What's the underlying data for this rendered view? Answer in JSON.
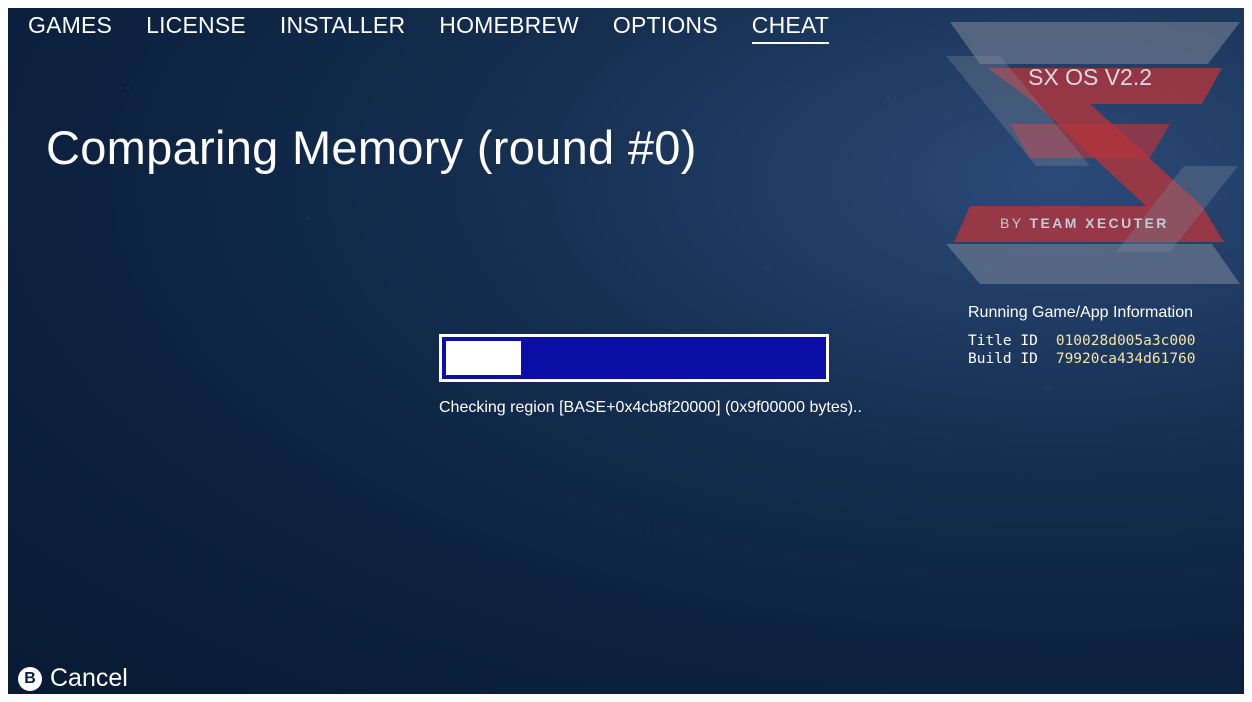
{
  "nav": {
    "items": [
      {
        "label": "GAMES",
        "active": false
      },
      {
        "label": "LICENSE",
        "active": false
      },
      {
        "label": "INSTALLER",
        "active": false
      },
      {
        "label": "HOMEBREW",
        "active": false
      },
      {
        "label": "OPTIONS",
        "active": false
      },
      {
        "label": "CHEAT",
        "active": true
      }
    ]
  },
  "main": {
    "title": "Comparing Memory (round #0)",
    "progress_fraction": 0.2,
    "status": "Checking region [BASE+0x4cb8f20000] (0x9f00000 bytes).."
  },
  "logo": {
    "version": "SX OS V2.2",
    "by_prefix": "BY",
    "by_team": "TEAM XECUTER"
  },
  "info": {
    "heading": "Running Game/App Information",
    "title_id_label": "Title ID",
    "title_id": "010028d005a3c000",
    "build_id_label": "Build ID",
    "build_id": "79920ca434d61760"
  },
  "footer": {
    "button_glyph": "B",
    "cancel_label": "Cancel"
  },
  "colors": {
    "background": "#0c2240",
    "progress_track": "#0b0fa6",
    "progress_fill": "#ffffff",
    "logo_red": "#b3343c",
    "logo_silver": "#7d8797",
    "id_value": "#f3e3a6"
  }
}
